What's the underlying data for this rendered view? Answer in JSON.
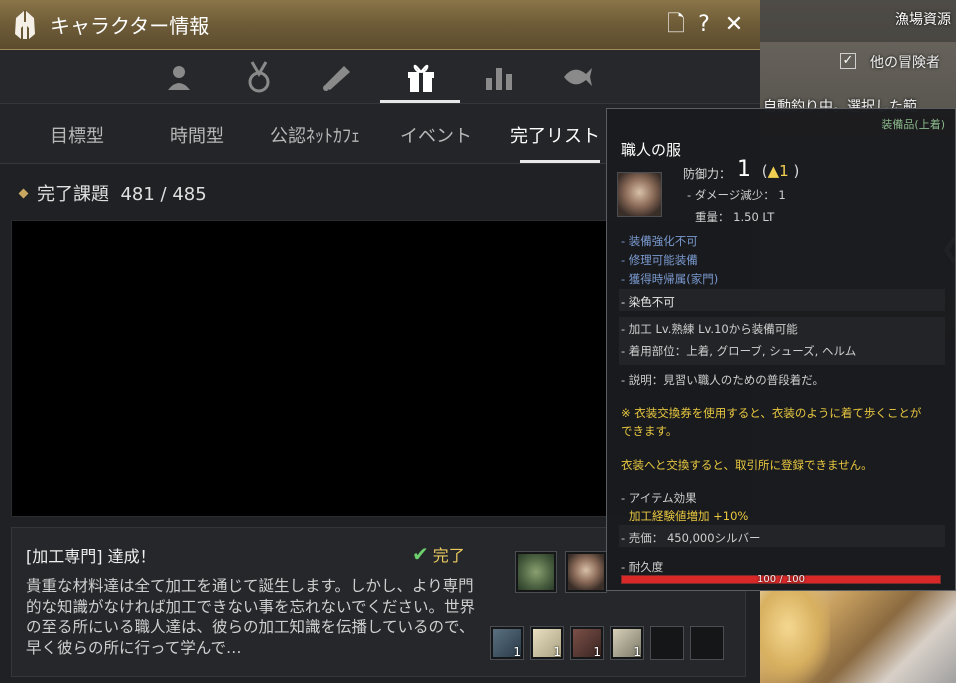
{
  "window": {
    "title": "キャラクター情報",
    "buttons": {
      "page": "🗋",
      "help": "?",
      "close": "✕"
    }
  },
  "categories": [
    "profile",
    "medal",
    "scroll",
    "gift",
    "stats",
    "fish"
  ],
  "tabs": [
    {
      "label": "目標型",
      "active": false
    },
    {
      "label": "時間型",
      "active": false
    },
    {
      "label": "公認ﾈｯﾄｶﾌｪ",
      "active": false
    },
    {
      "label": "イベント",
      "active": false
    },
    {
      "label": "完了リスト",
      "active": true
    }
  ],
  "completed": {
    "label": "完了課題",
    "value": "481 / 485"
  },
  "quest": {
    "title": "[加工専門] 達成！",
    "status": "完了",
    "description": "貴重な材料達は全て加工を通じて誕生します。しかし、より専門的な知識がなければ加工できない事を忘れないでください。世界の至る所にいる職人達は、彼らの加工知識を伝播しているので、早く彼らの所に行って学んで…",
    "rewards_top": [
      {
        "name": "tool-item",
        "count": ""
      },
      {
        "name": "clothes-item",
        "count": ""
      }
    ],
    "rewards_bottom": [
      {
        "name": "book-item",
        "count": "1"
      },
      {
        "name": "paper-item",
        "count": "1"
      },
      {
        "name": "leather-item",
        "count": "1"
      },
      {
        "name": "feather-item",
        "count": "1"
      },
      {
        "name": "empty-slot",
        "count": ""
      },
      {
        "name": "empty-slot",
        "count": ""
      }
    ]
  },
  "tooltip": {
    "category": "装備品(上着)",
    "name": "職人の服",
    "defense_label": "防御力：",
    "defense_value": "1",
    "defense_up": "1",
    "damage_reduction": "- ダメージ減少：  1",
    "weight": "重量：  1.50 LT",
    "attr1": "- 装備強化不可",
    "attr2": "- 修理可能装備",
    "attr3": "- 獲得時帰属(家門)",
    "dye": "- 染色不可",
    "requirement": "- 加工 Lv.熟練 Lv.10から装備可能",
    "slots": "- 着用部位：上着, グローブ, シューズ, ヘルム",
    "description": "- 説明：見習い職人のための普段着だ。",
    "note1a": "※ 衣装交換券を使用すると、衣装のように着て歩くことが",
    "note1b": "できます。",
    "note2": "衣装へと交換すると、取引所に登録できません。",
    "effect_label": "- アイテム効果",
    "effect_value": "加工経験値増加 +10%",
    "price": "- 売価：  450,000シルバー",
    "durability_label": "- 耐久度",
    "durability_text": "100 / 100",
    "durability_ratio": 1.0
  },
  "background": {
    "fishing_title": "漁場資源",
    "checkbox_label": "他の冒険者",
    "auto_fishing": "自動釣り中。選択した範",
    "chevron": "❮"
  }
}
